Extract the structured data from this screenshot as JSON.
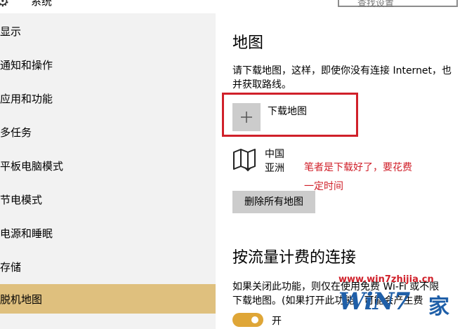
{
  "window": {
    "title": "系统",
    "search_placeholder": "查找设置"
  },
  "sidebar": {
    "items": [
      {
        "label": "显示"
      },
      {
        "label": "通知和操作"
      },
      {
        "label": "应用和功能"
      },
      {
        "label": "多任务"
      },
      {
        "label": "平板电脑模式"
      },
      {
        "label": "节电模式"
      },
      {
        "label": "电源和睡眠"
      },
      {
        "label": "存储"
      },
      {
        "label": "脱机地图",
        "selected": true
      }
    ]
  },
  "maps": {
    "heading": "地图",
    "description_line1": "请下载地图，这样，即使你没有连接 Internet，也",
    "description_line2": "并获取路线。",
    "download_label": "下载地图",
    "downloaded_region": "中国",
    "downloaded_continent": "亚洲",
    "annotation_line1": "笔者是下载好了，要花费",
    "annotation_line2": "一定时间",
    "delete_all_label": "删除所有地图"
  },
  "metered": {
    "heading": "按流量计费的连接",
    "description_line1": "如果关闭此功能，则仅在使用免费 Wi-Fi 或不限",
    "description_line2": "下载地图。(如果打开此功能，可能会产生费",
    "toggle_state_label": "开",
    "toggle_on": true
  },
  "watermark": {
    "url": "www.win7zhijia.cn",
    "logo_text": "WiN7",
    "logo_suffix": "家"
  },
  "colors": {
    "accent": "#dfc07e",
    "toggle": "#dfa637",
    "highlight_box": "#d0202a"
  }
}
